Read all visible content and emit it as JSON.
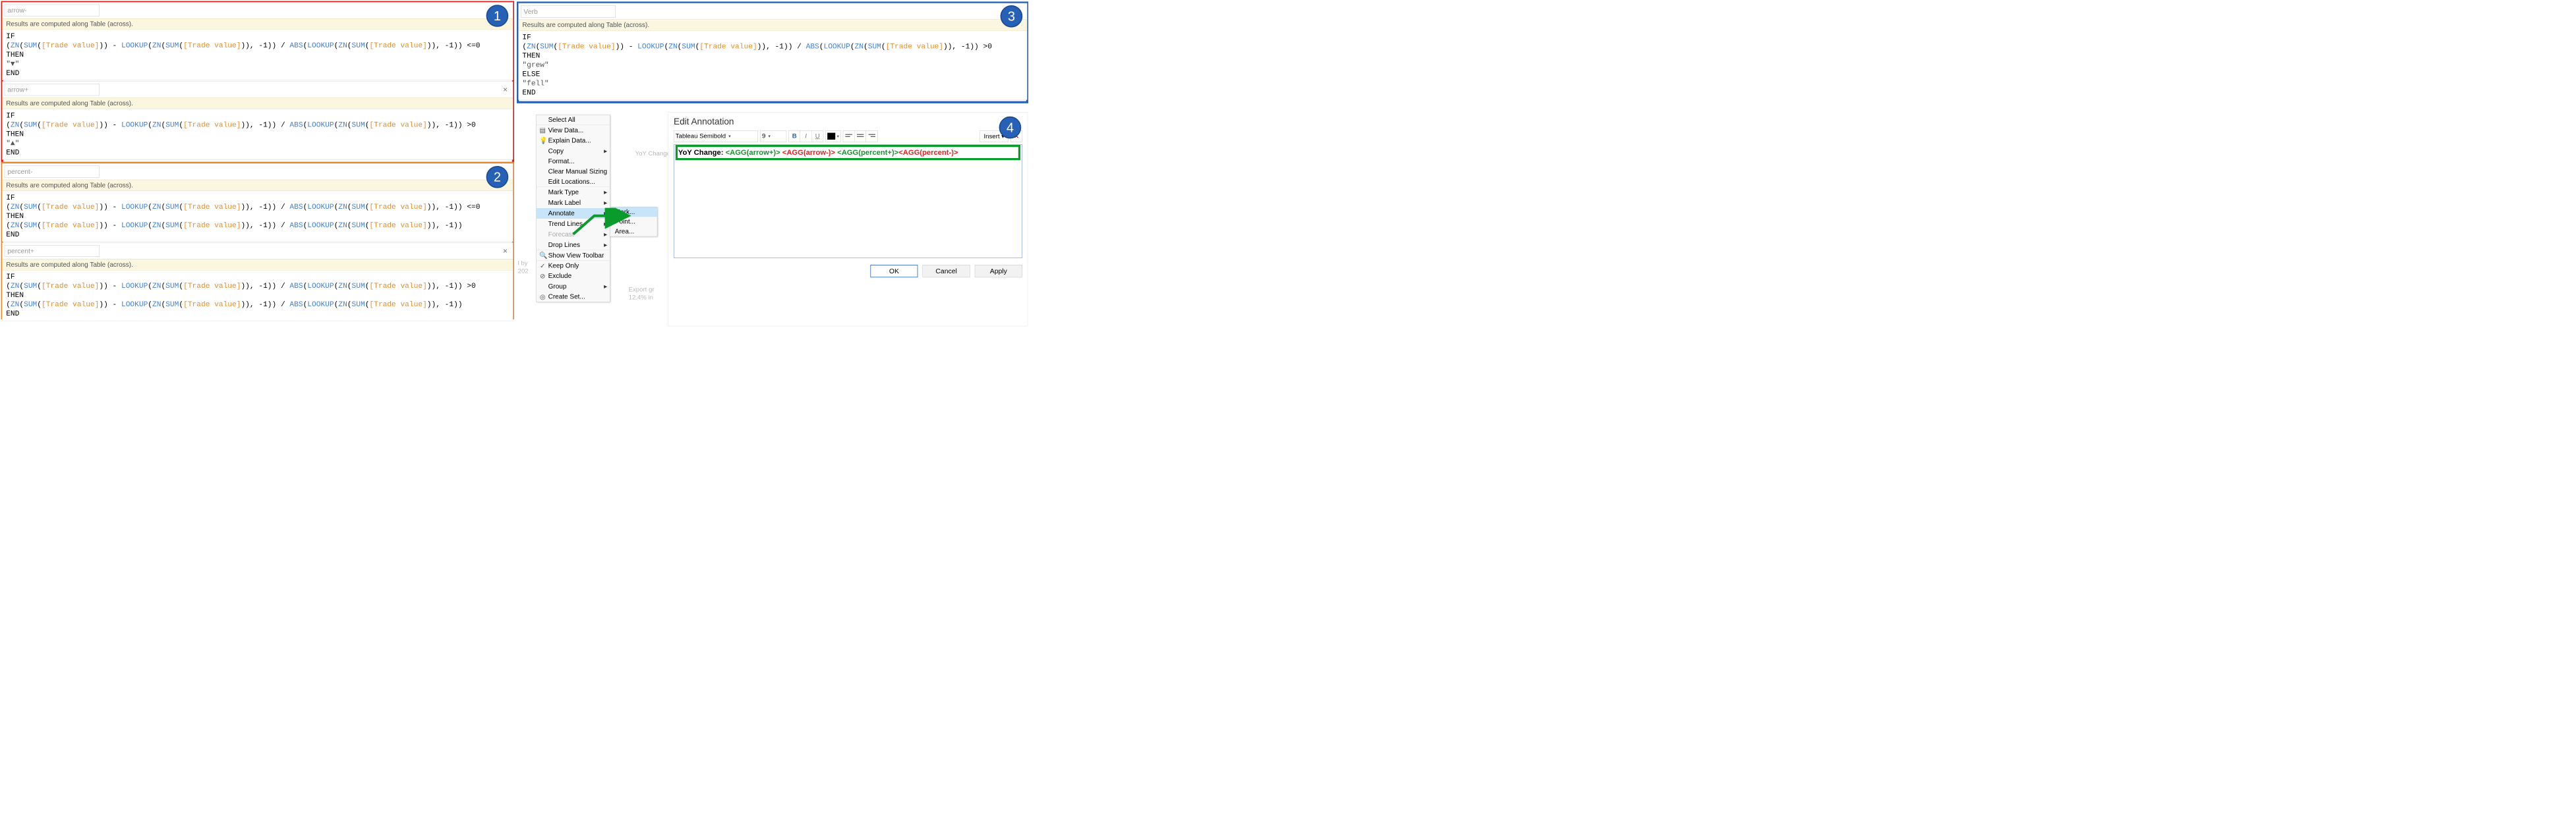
{
  "compute_msg": "Results are computed along Table (across).",
  "formulas": {
    "arrow_minus": {
      "name": "arrow-",
      "code_html": "<span class='kw'>IF</span>\n(<span class='fn'>ZN</span>(<span class='fn'>SUM</span>(<span class='fld'>[Trade value]</span>)) - <span class='fn'>LOOKUP</span>(<span class='fn'>ZN</span>(<span class='fn'>SUM</span>(<span class='fld'>[Trade value]</span>)), -1)) / <span class='fn'>ABS</span>(<span class='fn'>LOOKUP</span>(<span class='fn'>ZN</span>(<span class='fn'>SUM</span>(<span class='fld'>[Trade value]</span>)), -1)) &lt;=0\n<span class='kw'>THEN</span>\n<span class='str'>\"▼\"</span>\n<span class='kw'>END</span>"
    },
    "arrow_plus": {
      "name": "arrow+",
      "code_html": "<span class='kw'>IF</span>\n(<span class='fn'>ZN</span>(<span class='fn'>SUM</span>(<span class='fld'>[Trade value]</span>)) - <span class='fn'>LOOKUP</span>(<span class='fn'>ZN</span>(<span class='fn'>SUM</span>(<span class='fld'>[Trade value]</span>)), -1)) / <span class='fn'>ABS</span>(<span class='fn'>LOOKUP</span>(<span class='fn'>ZN</span>(<span class='fn'>SUM</span>(<span class='fld'>[Trade value]</span>)), -1)) &gt;0\n<span class='kw'>THEN</span>\n<span class='str'>\"▲\"</span>\n<span class='kw'>END</span>"
    },
    "percent_minus": {
      "name": "percent-",
      "code_html": "<span class='kw'>IF</span>\n(<span class='fn'>ZN</span>(<span class='fn'>SUM</span>(<span class='fld'>[Trade value]</span>)) - <span class='fn'>LOOKUP</span>(<span class='fn'>ZN</span>(<span class='fn'>SUM</span>(<span class='fld'>[Trade value]</span>)), -1)) / <span class='fn'>ABS</span>(<span class='fn'>LOOKUP</span>(<span class='fn'>ZN</span>(<span class='fn'>SUM</span>(<span class='fld'>[Trade value]</span>)), -1)) &lt;=0\n<span class='kw'>THEN</span>\n(<span class='fn'>ZN</span>(<span class='fn'>SUM</span>(<span class='fld'>[Trade value]</span>)) - <span class='fn'>LOOKUP</span>(<span class='fn'>ZN</span>(<span class='fn'>SUM</span>(<span class='fld'>[Trade value]</span>)), -1)) / <span class='fn'>ABS</span>(<span class='fn'>LOOKUP</span>(<span class='fn'>ZN</span>(<span class='fn'>SUM</span>(<span class='fld'>[Trade value]</span>)), -1))\n<span class='kw'>END</span>"
    },
    "percent_plus": {
      "name": "percent+",
      "code_html": "<span class='kw'>IF</span>\n(<span class='fn'>ZN</span>(<span class='fn'>SUM</span>(<span class='fld'>[Trade value]</span>)) - <span class='fn'>LOOKUP</span>(<span class='fn'>ZN</span>(<span class='fn'>SUM</span>(<span class='fld'>[Trade value]</span>)), -1)) / <span class='fn'>ABS</span>(<span class='fn'>LOOKUP</span>(<span class='fn'>ZN</span>(<span class='fn'>SUM</span>(<span class='fld'>[Trade value]</span>)), -1)) &gt;0\n<span class='kw'>THEN</span>\n(<span class='fn'>ZN</span>(<span class='fn'>SUM</span>(<span class='fld'>[Trade value]</span>)) - <span class='fn'>LOOKUP</span>(<span class='fn'>ZN</span>(<span class='fn'>SUM</span>(<span class='fld'>[Trade value]</span>)), -1)) / <span class='fn'>ABS</span>(<span class='fn'>LOOKUP</span>(<span class='fn'>ZN</span>(<span class='fn'>SUM</span>(<span class='fld'>[Trade value]</span>)), -1))\n<span class='kw'>END</span>"
    },
    "verb": {
      "name": "Verb",
      "code_html": "<span class='kw'>IF</span>\n(<span class='fn'>ZN</span>(<span class='fn'>SUM</span>(<span class='fld'>[Trade value]</span>)) - <span class='fn'>LOOKUP</span>(<span class='fn'>ZN</span>(<span class='fn'>SUM</span>(<span class='fld'>[Trade value]</span>)), -1)) / <span class='fn'>ABS</span>(<span class='fn'>LOOKUP</span>(<span class='fn'>ZN</span>(<span class='fn'>SUM</span>(<span class='fld'>[Trade value]</span>)), -1)) &gt;0\n<span class='kw'>THEN</span>\n<span class='str'>\"grew\"</span>\n<span class='kw'>ELSE</span>\n<span class='str'>\"fell\"</span>\n<span class='kw'>END</span>"
    }
  },
  "context_menu": {
    "items": [
      {
        "label": "Select All",
        "icon": "",
        "sub": false,
        "sep": true
      },
      {
        "label": "View Data...",
        "icon": "▤",
        "sub": false
      },
      {
        "label": "Explain Data...",
        "icon": "💡",
        "sub": false
      },
      {
        "label": "Copy",
        "icon": "",
        "sub": true
      },
      {
        "label": "Format...",
        "icon": "",
        "sub": false
      },
      {
        "label": "Clear Manual Sizing",
        "icon": "",
        "sub": false
      },
      {
        "label": "Edit Locations...",
        "icon": "",
        "sub": false,
        "sep": true
      },
      {
        "label": "Mark Type",
        "icon": "",
        "sub": true
      },
      {
        "label": "Mark Label",
        "icon": "",
        "sub": true
      },
      {
        "label": "Annotate",
        "icon": "",
        "sub": true,
        "highlight": true
      },
      {
        "label": "Trend Lines",
        "icon": "",
        "sub": true
      },
      {
        "label": "Forecast",
        "icon": "",
        "sub": true,
        "disabled": true
      },
      {
        "label": "Drop Lines",
        "icon": "",
        "sub": true,
        "sep": true
      },
      {
        "label": "Show View Toolbar",
        "icon": "🔍",
        "sub": false,
        "sep": true
      },
      {
        "label": "Keep Only",
        "icon": "✓",
        "sub": false
      },
      {
        "label": "Exclude",
        "icon": "⊘",
        "sub": false
      },
      {
        "label": "Group",
        "icon": "",
        "sub": true
      },
      {
        "label": "Create Set...",
        "icon": "◎",
        "sub": false
      }
    ],
    "submenu": [
      {
        "label": "Mark...",
        "highlight": true
      },
      {
        "label": "Point..."
      },
      {
        "label": "Area..."
      }
    ]
  },
  "edit_panel": {
    "title": "Edit Annotation",
    "font": "Tableau Semibold",
    "size": "9",
    "bold": "B",
    "italic": "I",
    "underline": "U",
    "insert": "Insert ▾",
    "close": "✕",
    "annotation_prefix": "YoY Change: ",
    "tags": [
      "<AGG(arrow+)>",
      "<AGG(arrow-)>",
      "<AGG(percent+)>",
      "<AGG(percent-)>"
    ],
    "ok": "OK",
    "cancel": "Cancel",
    "apply": "Apply"
  },
  "badges": {
    "b1": "1",
    "b2": "2",
    "b3": "3",
    "b4": "4"
  },
  "bg_hints": {
    "yoy": "YoY Change:",
    "lby": "l by",
    "y2020": "202",
    "export": "Export gr",
    "pct": "12.4% in"
  }
}
